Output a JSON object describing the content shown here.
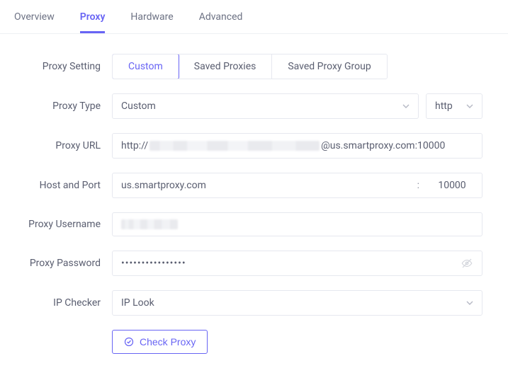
{
  "tabs": {
    "overview": "Overview",
    "proxy": "Proxy",
    "hardware": "Hardware",
    "advanced": "Advanced",
    "active": "proxy"
  },
  "labels": {
    "proxy_setting": "Proxy Setting",
    "proxy_type": "Proxy Type",
    "proxy_url": "Proxy URL",
    "host_port": "Host and Port",
    "proxy_username": "Proxy Username",
    "proxy_password": "Proxy Password",
    "ip_checker": "IP Checker"
  },
  "proxy_setting_options": {
    "custom": "Custom",
    "saved_proxies": "Saved Proxies",
    "saved_proxy_group": "Saved Proxy Group",
    "active": "custom"
  },
  "proxy_type": {
    "value": "Custom",
    "protocol": "http"
  },
  "proxy_url": {
    "prefix": "http://",
    "suffix": "@us.smartproxy.com:10000"
  },
  "host_port": {
    "host": "us.smartproxy.com",
    "port": "10000",
    "separator": ":"
  },
  "proxy_username": "",
  "proxy_password": "••••••••••••••••",
  "ip_checker": "IP Look",
  "check_proxy_label": "Check Proxy"
}
